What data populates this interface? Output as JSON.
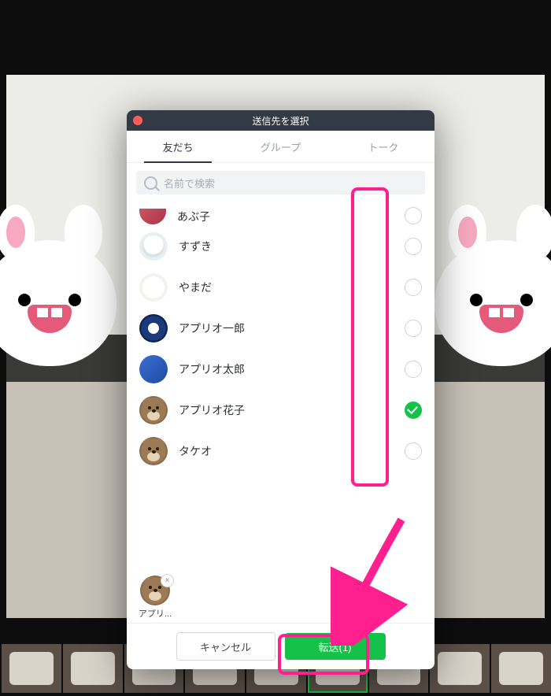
{
  "dialog_title": "送信先を選択",
  "tabs": [
    "友だち",
    "グループ",
    "トーク"
  ],
  "active_tab": 0,
  "search_placeholder": "名前で検索",
  "friends": [
    {
      "name": "あぶ子",
      "selected": false,
      "partial": true
    },
    {
      "name": "すずき",
      "selected": false
    },
    {
      "name": "やまだ",
      "selected": false
    },
    {
      "name": "アプリオ一郎",
      "selected": false
    },
    {
      "name": "アプリオ太郎",
      "selected": false
    },
    {
      "name": "アプリオ花子",
      "selected": true
    },
    {
      "name": "タケオ",
      "selected": false
    }
  ],
  "selected_chip": {
    "label": "アプリ..."
  },
  "buttons": {
    "cancel": "キャンセル",
    "send": "転送(1)"
  },
  "thumb_count": 9,
  "thumb_selected_index": 5
}
